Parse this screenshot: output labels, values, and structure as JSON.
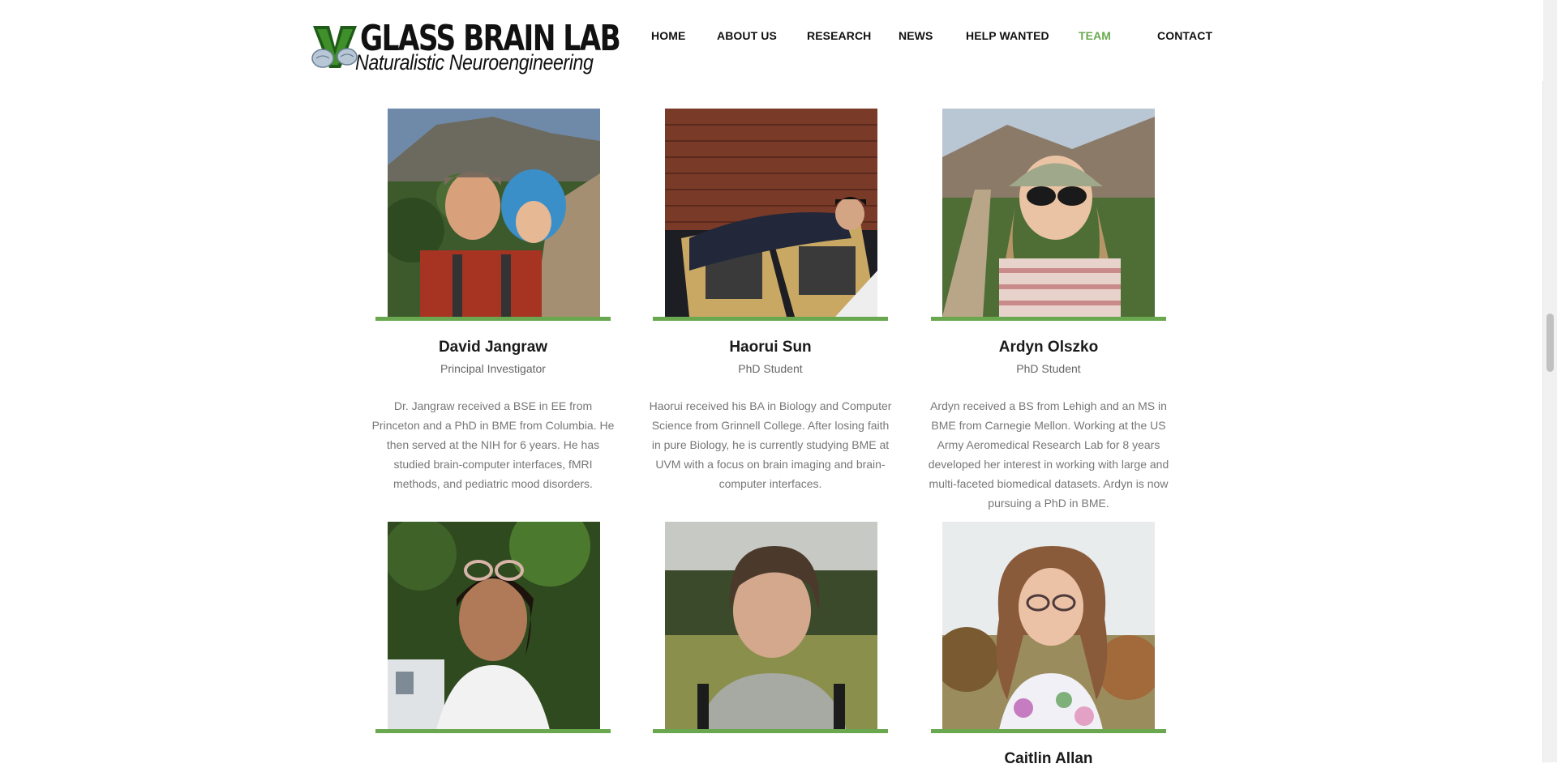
{
  "header": {
    "logo_title": "GLASS BRAIN LAB",
    "logo_subtitle": "Naturalistic Neuroengineering",
    "logo_icon": "v-logo-icon",
    "nav": [
      {
        "label": "HOME"
      },
      {
        "label": "ABOUT US"
      },
      {
        "label": "RESEARCH"
      },
      {
        "label": "NEWS"
      },
      {
        "label": "HELP WANTED"
      },
      {
        "label": "TEAM",
        "active": true
      },
      {
        "label": "CONTACT"
      }
    ]
  },
  "colors": {
    "accent_green": "#6aa84f",
    "text_dark": "#1a1a1a",
    "text_muted": "#777777"
  },
  "team": [
    {
      "name": "David Jangraw",
      "role": "Principal Investigator",
      "bio": "Dr. Jangraw received a BSE in EE from Princeton and a PhD in BME from Columbia. He then served at the NIH for 6 years. He has studied brain-computer interfaces, fMRI methods, and pediatric mood disorders."
    },
    {
      "name": "Haorui Sun",
      "role": "PhD Student",
      "bio": "Haorui received his BA in Biology and Computer Science from Grinnell College. After losing faith in pure Biology, he is currently studying BME at UVM with a focus on brain imaging and brain-computer interfaces."
    },
    {
      "name": "Ardyn Olszko",
      "role": "PhD Student",
      "bio": "Ardyn received a BS from Lehigh and an MS in BME from Carnegie Mellon. Working at the US Army Aeromedical Research Lab for 8 years developed her interest in working with large and multi-faceted biomedical datasets. Ardyn is now pursuing a PhD in BME."
    },
    {
      "name": "",
      "role": "",
      "bio": ""
    },
    {
      "name": "",
      "role": "",
      "bio": ""
    },
    {
      "name": "Caitlin Allan",
      "role": "",
      "bio": ""
    }
  ]
}
